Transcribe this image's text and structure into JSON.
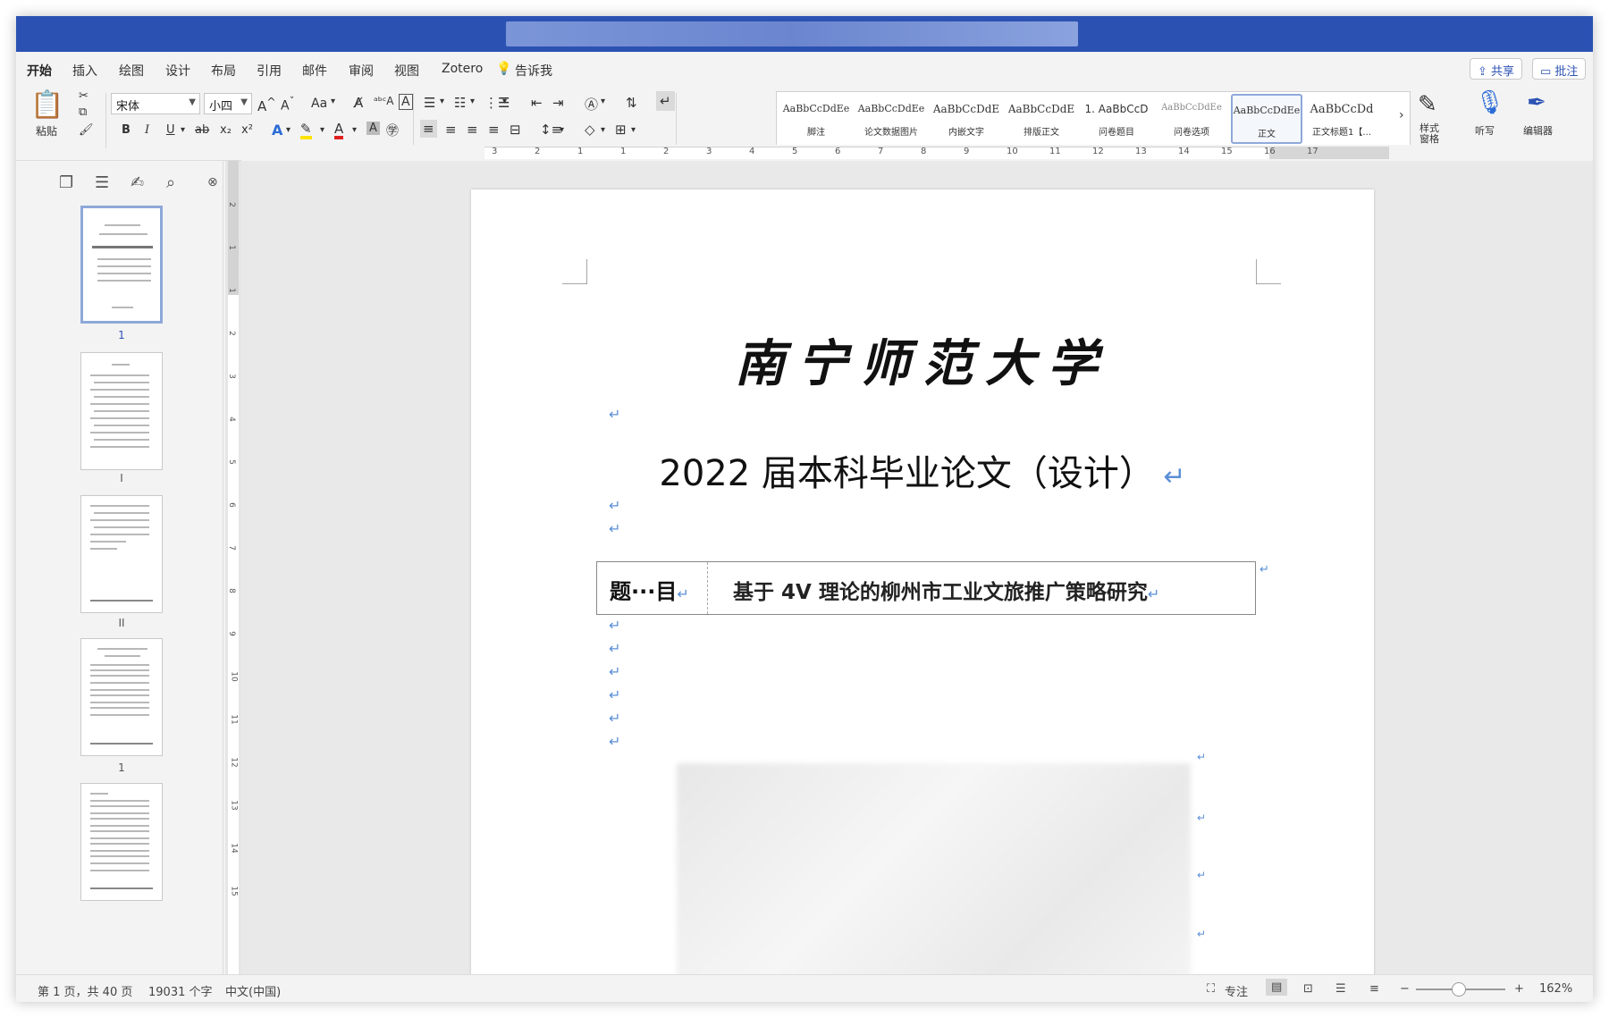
{
  "tabs": [
    "开始",
    "插入",
    "绘图",
    "设计",
    "布局",
    "引用",
    "邮件",
    "审阅",
    "视图",
    "Zotero",
    "告诉我"
  ],
  "top_buttons": {
    "share": "共享",
    "comment": "批注"
  },
  "ribbon": {
    "paste_label": "粘贴",
    "font_name": "宋体",
    "font_size": "小四",
    "aa_label": "Aa",
    "bold": "B",
    "italic": "I",
    "underline": "U",
    "strike": "ab",
    "subscript": "x₂",
    "superscript": "x²",
    "dictation_label": "听写",
    "editor_label": "编辑器",
    "styles_pane_label": "样式\n窗格"
  },
  "styles": [
    {
      "preview": "AaBbCcDdEe",
      "name": "脚注"
    },
    {
      "preview": "AaBbCcDdEe",
      "name": "论文数据图片"
    },
    {
      "preview": "AaBbCcDdE",
      "name": "内嵌文字"
    },
    {
      "preview": "AaBbCcDdE",
      "name": "排版正文"
    },
    {
      "preview": "1. AaBbCcD",
      "name": "问卷题目"
    },
    {
      "preview": "AaBbCcDdEe",
      "name": "问卷选项"
    },
    {
      "preview": "AaBbCcDdEe",
      "name": "正文"
    },
    {
      "preview": "AaBbCcDd",
      "name": "正文标题1【..."
    }
  ],
  "ruler_numbers": [
    "3",
    "2",
    "1",
    "1",
    "2",
    "3",
    "4",
    "5",
    "6",
    "7",
    "8",
    "9",
    "10",
    "11",
    "12",
    "13",
    "14",
    "15",
    "16",
    "17"
  ],
  "vruler_numbers": [
    "2",
    "1",
    "1",
    "2",
    "3",
    "4",
    "5",
    "6",
    "7",
    "8",
    "9",
    "10",
    "11",
    "12",
    "13",
    "14",
    "15"
  ],
  "thumbnails": [
    {
      "label": "1"
    },
    {
      "label": "I"
    },
    {
      "label": "II"
    },
    {
      "label": "1"
    },
    {
      "label": ""
    }
  ],
  "document": {
    "university": "南宁师范大学",
    "thesis_heading": "2022 届本科毕业论文（设计）",
    "title_label": "题···目",
    "title_value": "基于 4V 理论的柳州市工业文旅推广策略研究"
  },
  "status": {
    "page": "第 1 页，共 40 页",
    "words": "19031 个字",
    "language": "中文(中国)",
    "focus": "专注",
    "zoom": "162%"
  }
}
